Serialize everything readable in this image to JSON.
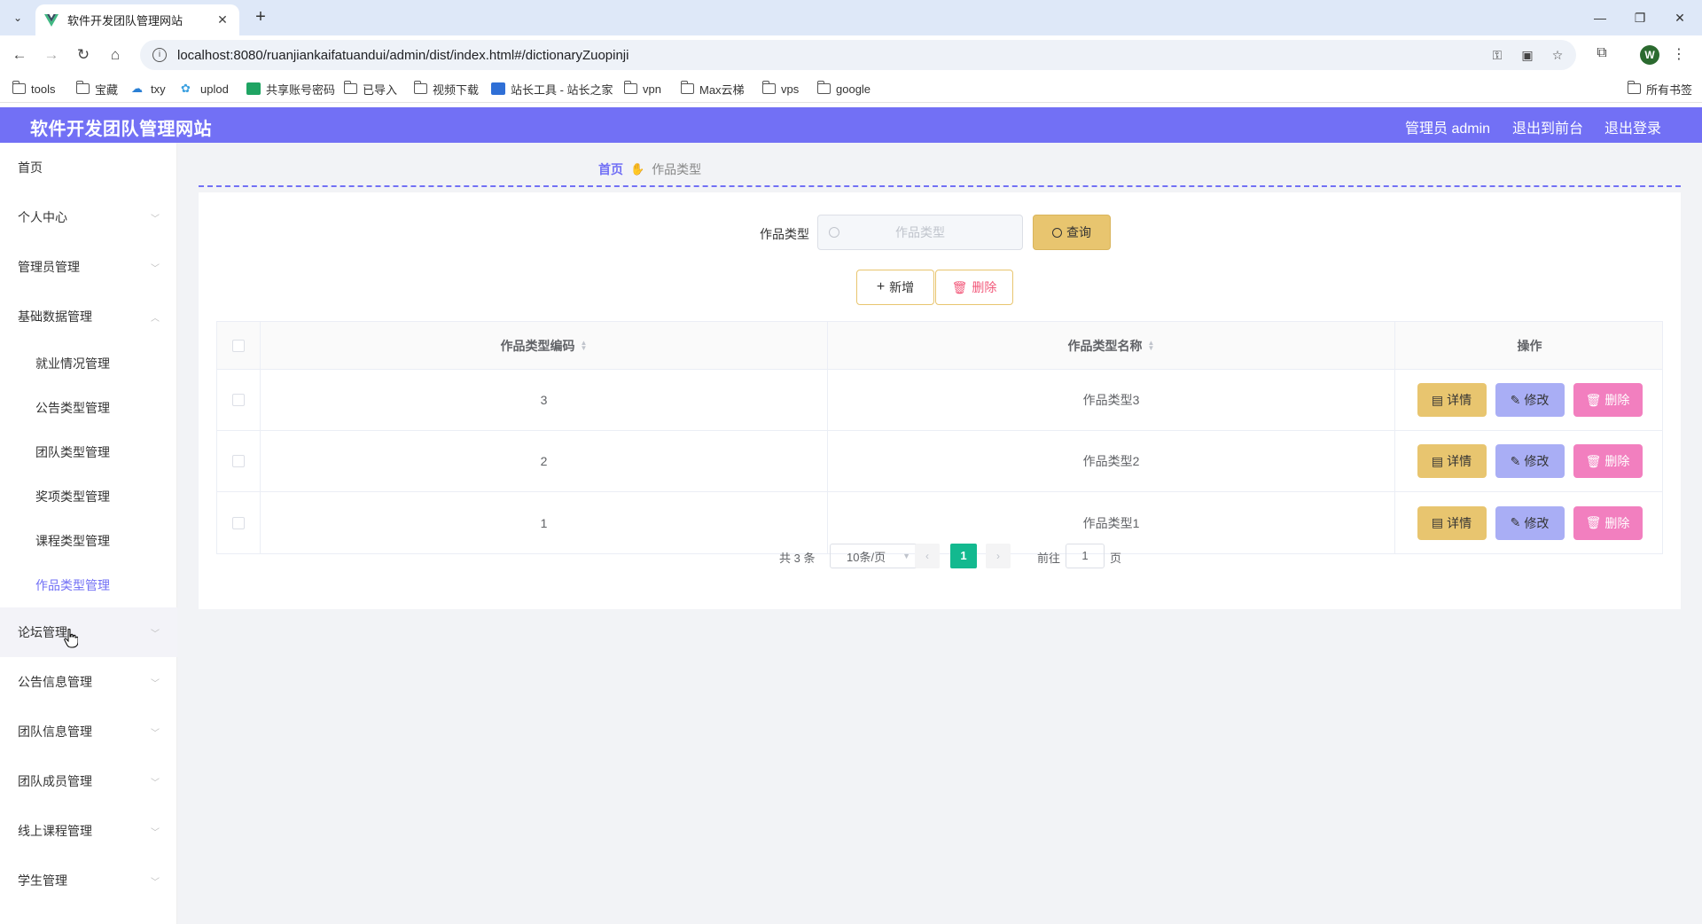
{
  "browser": {
    "tab_title": "软件开发团队管理网站",
    "url": "localhost:8080/ruanjiankaifatuandui/admin/dist/index.html#/dictionaryZuopinji",
    "bookmarks": [
      "tools",
      "宝藏",
      "txy",
      "uplod",
      "共享账号密码",
      "已导入",
      "视频下载",
      "站长工具 - 站长之家",
      "vpn",
      "Max云梯",
      "vps",
      "google"
    ],
    "all_bookmarks": "所有书签",
    "profile_initial": "W"
  },
  "header": {
    "title": "软件开发团队管理网站",
    "admin_label": "管理员 admin",
    "to_front": "退出到前台",
    "logout": "退出登录",
    "color": "#7270f5"
  },
  "sidebar": {
    "home": "首页",
    "personal": "个人中心",
    "admin_mgmt": "管理员管理",
    "basic_data": "基础数据管理",
    "sub": [
      "就业情况管理",
      "公告类型管理",
      "团队类型管理",
      "奖项类型管理",
      "课程类型管理",
      "作品类型管理"
    ],
    "forum": "论坛管理",
    "notice_info": "公告信息管理",
    "team_info": "团队信息管理",
    "team_members": "团队成员管理",
    "online_course": "线上课程管理",
    "student": "学生管理"
  },
  "breadcrumb": {
    "home": "首页",
    "current": "作品类型"
  },
  "search": {
    "label": "作品类型",
    "placeholder": "作品类型",
    "query_btn": "查询"
  },
  "actions": {
    "add": "新增",
    "delete": "删除"
  },
  "table": {
    "headers": {
      "code": "作品类型编码",
      "name": "作品类型名称",
      "ops": "操作"
    },
    "rows": [
      {
        "code": "3",
        "name": "作品类型3"
      },
      {
        "code": "2",
        "name": "作品类型2"
      },
      {
        "code": "1",
        "name": "作品类型1"
      }
    ],
    "op_detail": "详情",
    "op_edit": "修改",
    "op_delete": "删除"
  },
  "pager": {
    "total": "共 3 条",
    "page_size": "10条/页",
    "current": "1",
    "goto": "前往",
    "goto_value": "1",
    "page_unit": "页"
  }
}
